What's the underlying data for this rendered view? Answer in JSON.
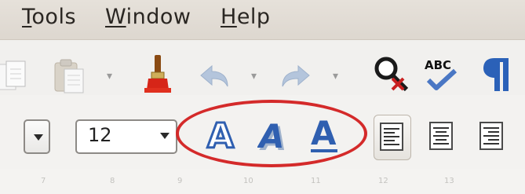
{
  "menubar": {
    "items": [
      {
        "label": "Tools",
        "mnemonic": "T",
        "rest": "ools"
      },
      {
        "label": "Window",
        "mnemonic": "W",
        "rest": "indow"
      },
      {
        "label": "Help",
        "mnemonic": "H",
        "rest": "elp"
      }
    ]
  },
  "toolbar1": {
    "icons": [
      "copy-icon",
      "paste-icon",
      "clone-formatting-icon",
      "undo-icon",
      "redo-icon",
      "find-replace-icon",
      "spellcheck-icon",
      "formatting-marks-icon"
    ],
    "spellcheck_text": "ABC"
  },
  "toolbar2": {
    "font_size": "12",
    "effects": [
      "outline-icon",
      "shadow-icon",
      "underline-a-icon"
    ],
    "alignment": [
      "align-left-icon",
      "align-center-icon",
      "align-right-icon"
    ],
    "active_alignment": "align-left",
    "highlight_color": "#d42a2a",
    "effect_color": "#2f5fb0"
  },
  "ruler": {
    "numbers": [
      "7",
      "8",
      "9",
      "10",
      "11",
      "12",
      "13"
    ]
  }
}
